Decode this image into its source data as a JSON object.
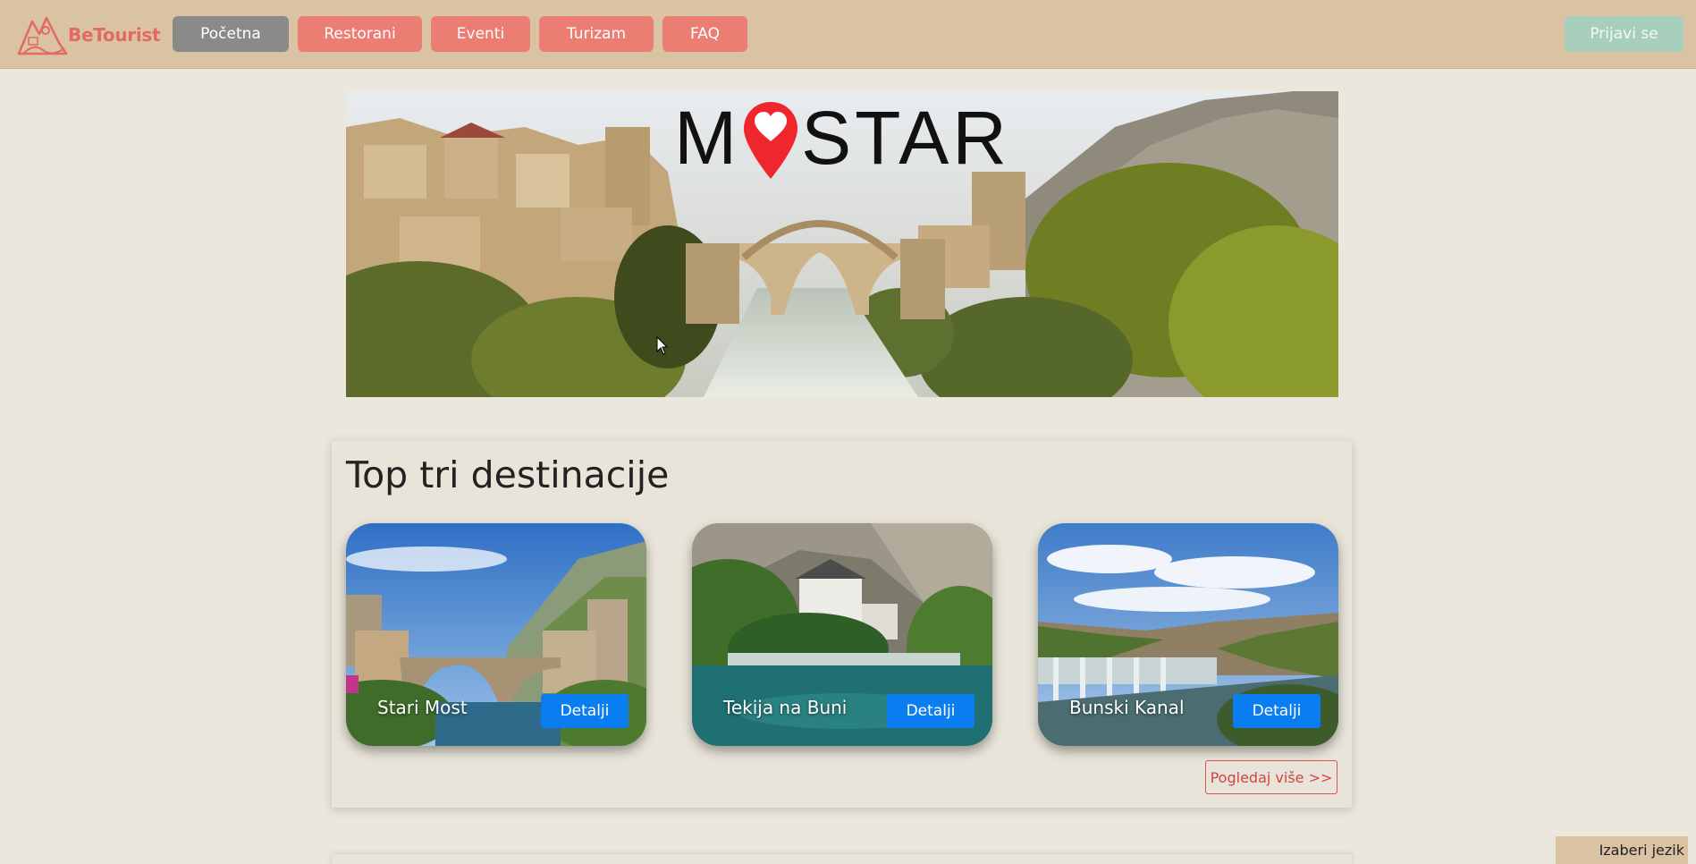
{
  "nav": {
    "logo_text": "BeTourist",
    "items": [
      {
        "label": "Početna",
        "active": true
      },
      {
        "label": "Restorani"
      },
      {
        "label": "Eventi"
      },
      {
        "label": "Turizam"
      },
      {
        "label": "FAQ"
      }
    ],
    "login_label": "Prijavi se"
  },
  "hero": {
    "title_left": "M",
    "title_right": "STAR",
    "pin_icon": "heart-pin-icon"
  },
  "top": {
    "title": "Top tri destinacije",
    "cards": [
      {
        "name": "Stari Most",
        "button": "Detalji"
      },
      {
        "name": "Tekija na Buni",
        "button": "Detalji"
      },
      {
        "name": "Bunski Kanal",
        "button": "Detalji"
      }
    ],
    "more_label": "Pogledaj više >>"
  },
  "language_label": "Izaberi jezik",
  "colors": {
    "navbar": "#d9c3a3",
    "nav_button": "#ec7d72",
    "nav_active": "#8a8a89",
    "login": "#a8cfbc",
    "detail_button": "#0a7df0",
    "page_bg": "#ebe7dc"
  }
}
